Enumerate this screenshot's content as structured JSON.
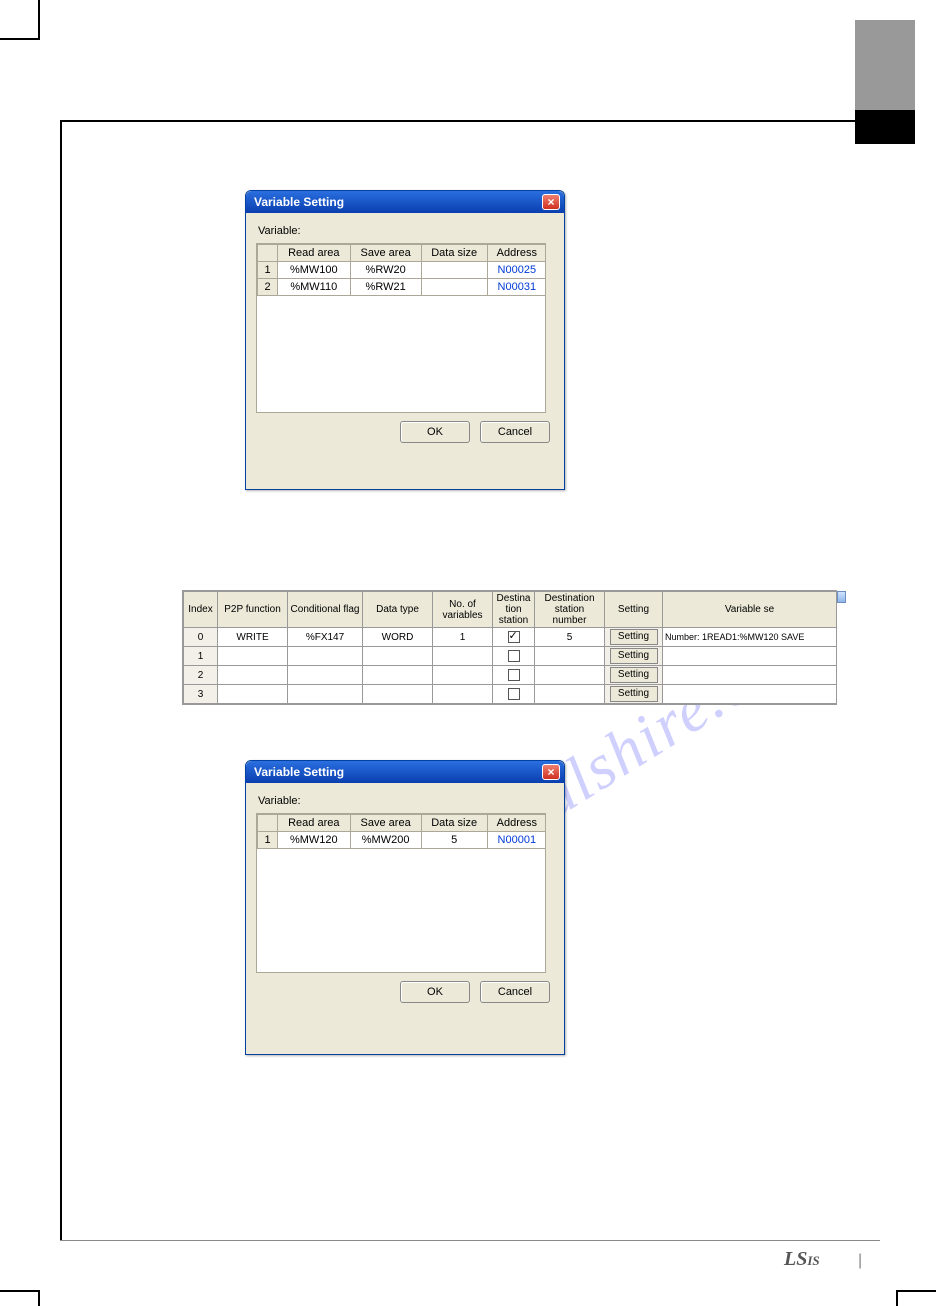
{
  "watermark": "manualshire.com",
  "footer": {
    "logo": "LS",
    "logo_sub": "IS",
    "pipe": "|"
  },
  "dialog1": {
    "title": "Variable Setting",
    "label": "Variable:",
    "headers": {
      "read": "Read area",
      "save": "Save area",
      "size": "Data size",
      "addr": "Address"
    },
    "rows": [
      {
        "num": "1",
        "read": "%MW100",
        "save": "%RW20",
        "size": "",
        "addr": "N00025"
      },
      {
        "num": "2",
        "read": "%MW110",
        "save": "%RW21",
        "size": "",
        "addr": "N00031"
      }
    ],
    "ok": "OK",
    "cancel": "Cancel"
  },
  "p2p": {
    "headers": {
      "index": "Index",
      "func": "P2P function",
      "flag": "Conditional flag",
      "dtype": "Data type",
      "nvars": "No. of variables",
      "dest": "Destina tion station",
      "destnum": "Destination station number",
      "setting": "Setting",
      "varset": "Variable se"
    },
    "setting_label": "Setting",
    "rows": [
      {
        "index": "0",
        "func": "WRITE",
        "flag": "%FX147",
        "dtype": "WORD",
        "nvars": "1",
        "checked": true,
        "destnum": "5",
        "varset": "Number:\n1READ1:%MW120 SAVE"
      },
      {
        "index": "1",
        "func": "",
        "flag": "",
        "dtype": "",
        "nvars": "",
        "checked": false,
        "destnum": "",
        "varset": ""
      },
      {
        "index": "2",
        "func": "",
        "flag": "",
        "dtype": "",
        "nvars": "",
        "checked": false,
        "destnum": "",
        "varset": ""
      },
      {
        "index": "3",
        "func": "",
        "flag": "",
        "dtype": "",
        "nvars": "",
        "checked": false,
        "destnum": "",
        "varset": ""
      }
    ]
  },
  "dialog2": {
    "title": "Variable Setting",
    "label": "Variable:",
    "headers": {
      "read": "Read area",
      "save": "Save area",
      "size": "Data size",
      "addr": "Address"
    },
    "rows": [
      {
        "num": "1",
        "read": "%MW120",
        "save": "%MW200",
        "size": "5",
        "addr": "N00001"
      }
    ],
    "ok": "OK",
    "cancel": "Cancel"
  }
}
